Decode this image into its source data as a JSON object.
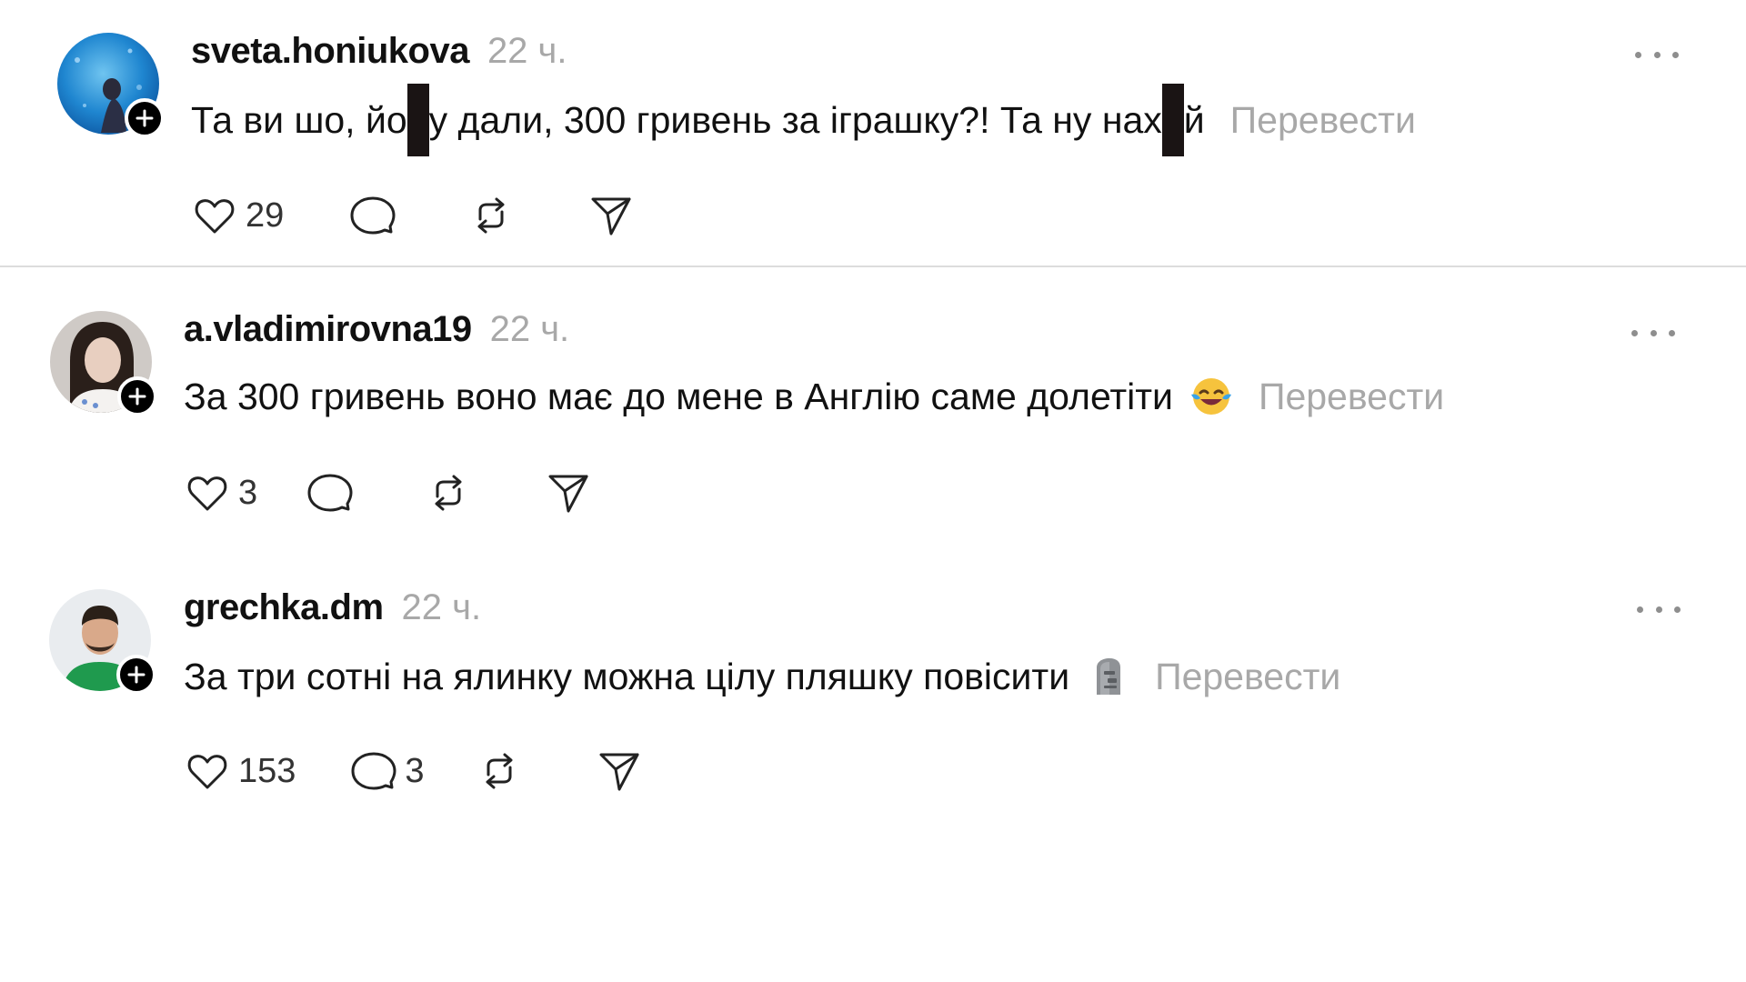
{
  "posts": [
    {
      "username": "sveta.honiukova",
      "time": "22 ч.",
      "text_parts": [
        "Та ви шо, йо",
        "у дали, 300 гривень за іграшку?! Та ну нах",
        "й"
      ],
      "translate": "Перевести",
      "likes": "29",
      "replies": "",
      "avatar": "avatar-photo-blue",
      "icons": [
        "heart-icon",
        "comment-icon",
        "repost-icon",
        "share-icon",
        "more-icon",
        "plus-icon"
      ]
    },
    {
      "username": "a.vladimirovna19",
      "time": "22 ч.",
      "text": "За 300 гривень воно має до мене в Англію саме долетіти",
      "emoji": "tears-of-joy-emoji",
      "translate": "Перевести",
      "likes": "3",
      "replies": "",
      "avatar": "avatar-photo-woman",
      "icons": [
        "heart-icon",
        "comment-icon",
        "repost-icon",
        "share-icon",
        "more-icon",
        "plus-icon"
      ]
    },
    {
      "username": "grechka.dm",
      "time": "22 ч.",
      "text": "За три сотні на ялинку можна цілу пляшку повісити",
      "emoji": "moai-emoji",
      "translate": "Перевести",
      "likes": "153",
      "replies": "3",
      "avatar": "avatar-photo-man",
      "icons": [
        "heart-icon",
        "comment-icon",
        "repost-icon",
        "share-icon",
        "more-icon",
        "plus-icon"
      ]
    }
  ],
  "colors": {
    "text": "#111111",
    "muted": "#a8a8a8",
    "divider": "#dcdcdc",
    "badge": "#000000"
  }
}
